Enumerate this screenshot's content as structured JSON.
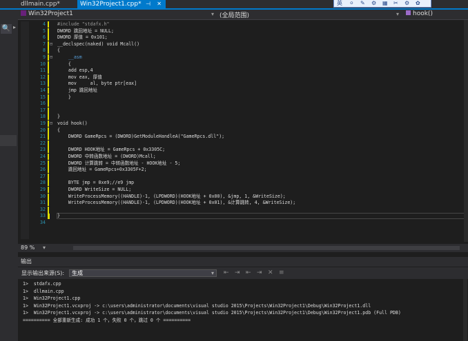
{
  "tabs": [
    {
      "label": "dllmain.cpp*"
    },
    {
      "label": "Win32Project1.cpp*",
      "pin": "⊣",
      "close": "✕"
    }
  ],
  "floating_toolbar": {
    "items": [
      "英",
      "⚪",
      "✎",
      "⚙",
      "▦",
      "✂",
      "⚙",
      "✿"
    ]
  },
  "nav": {
    "project": "Win32Project1",
    "scope": "(全局范围)",
    "function": "hook()",
    "dropdown_glyph": "▾"
  },
  "left_panel": {
    "search_glyph": "🔍",
    "arrow_glyph": "▸"
  },
  "editor": {
    "lines": [
      {
        "num": "4",
        "fold": "",
        "chg": true,
        "text": "#include \"stdafx.h\"",
        "color": "#9b9b9b"
      },
      {
        "num": "5",
        "fold": "",
        "chg": true,
        "text": "DWORD 跳回地址 = NULL;",
        "color": "#dcdcdc"
      },
      {
        "num": "6",
        "fold": "",
        "chg": true,
        "text": "DWORD 厚值 = 0x101;",
        "color": "#dcdcdc"
      },
      {
        "num": "7",
        "fold": "⊟",
        "chg": true,
        "text": "__declspec(naked) void Mcall()",
        "color": "#dcdcdc"
      },
      {
        "num": "8",
        "fold": "",
        "chg": true,
        "text": "{",
        "color": "#dcdcdc"
      },
      {
        "num": "9",
        "fold": "⊟",
        "chg": true,
        "text": "    __asm",
        "color": "#569cd6"
      },
      {
        "num": "10",
        "fold": "",
        "chg": true,
        "text": "    {",
        "color": "#dcdcdc"
      },
      {
        "num": "11",
        "fold": "",
        "chg": true,
        "text": "    add esp,4",
        "color": "#dcdcdc"
      },
      {
        "num": "12",
        "fold": "",
        "chg": true,
        "text": "    mov eax, 厚值",
        "color": "#dcdcdc"
      },
      {
        "num": "13",
        "fold": "",
        "chg": true,
        "text": "    mov     al, byte ptr[eax]",
        "color": "#dcdcdc"
      },
      {
        "num": "14",
        "fold": "",
        "chg": true,
        "text": "    jmp 跳回地址",
        "color": "#dcdcdc"
      },
      {
        "num": "15",
        "fold": "",
        "chg": true,
        "text": "    }",
        "color": "#dcdcdc"
      },
      {
        "num": "16",
        "fold": "",
        "chg": true,
        "text": "",
        "color": "#dcdcdc"
      },
      {
        "num": "17",
        "fold": "",
        "chg": true,
        "text": "",
        "color": "#dcdcdc"
      },
      {
        "num": "18",
        "fold": "",
        "chg": true,
        "text": "}",
        "color": "#dcdcdc"
      },
      {
        "num": "19",
        "fold": "⊟",
        "chg": true,
        "text": "void hook()",
        "color": "#dcdcdc"
      },
      {
        "num": "20",
        "fold": "",
        "chg": true,
        "text": "{",
        "color": "#dcdcdc"
      },
      {
        "num": "21",
        "fold": "",
        "chg": true,
        "text": "    DWORD GameRpcs = (DWORD)GetModuleHandleA(\"GameRpcs.dll\");",
        "color": "#dcdcdc"
      },
      {
        "num": "22",
        "fold": "",
        "chg": true,
        "text": "",
        "color": "#dcdcdc"
      },
      {
        "num": "23",
        "fold": "",
        "chg": true,
        "text": "    DWORD HOOK地址 = GameRpcs + 0x3305C;",
        "color": "#dcdcdc"
      },
      {
        "num": "24",
        "fold": "",
        "chg": true,
        "text": "    DWORD 中转函数地址 = (DWORD)Mcall;",
        "color": "#dcdcdc"
      },
      {
        "num": "25",
        "fold": "",
        "chg": true,
        "text": "    DWORD 计算跳转 = 中转函数地址 - HOOK地址 - 5;",
        "color": "#dcdcdc"
      },
      {
        "num": "26",
        "fold": "",
        "chg": true,
        "text": "    跳回地址 = GameRpcs+0x3305F+2;",
        "color": "#dcdcdc"
      },
      {
        "num": "27",
        "fold": "",
        "chg": true,
        "text": "",
        "color": "#dcdcdc"
      },
      {
        "num": "28",
        "fold": "",
        "chg": true,
        "text": "    BYTE jmp = 0xe9;//e9 jmp",
        "color": "#dcdcdc"
      },
      {
        "num": "29",
        "fold": "",
        "chg": true,
        "text": "    DWORD WriteSize = NULL;",
        "color": "#dcdcdc"
      },
      {
        "num": "30",
        "fold": "",
        "chg": true,
        "text": "    WriteProcessMemory((HANDLE)-1, (LPDWORD)(HOOK地址 + 0x00), &jmp, 1, &WriteSize);",
        "color": "#dcdcdc"
      },
      {
        "num": "31",
        "fold": "",
        "chg": true,
        "text": "    WriteProcessMemory((HANDLE)-1, (LPDWORD)(HOOK地址 + 0x01), &计算跳转, 4, &WriteSize);",
        "color": "#dcdcdc"
      },
      {
        "num": "32",
        "fold": "",
        "chg": true,
        "text": "",
        "color": "#dcdcdc"
      },
      {
        "num": "33",
        "fold": "",
        "chg": true,
        "text": "}",
        "color": "#dcdcdc"
      },
      {
        "num": "34",
        "fold": "",
        "chg": false,
        "text": "",
        "color": "#dcdcdc"
      }
    ]
  },
  "zoom": {
    "level": "89 %",
    "dropdown": "▾"
  },
  "output": {
    "title": "输出",
    "source_label": "显示输出来源(S):",
    "source_value": "生成",
    "toolbar_glyphs": [
      "⇤",
      "⇥",
      "⇤",
      "⇥",
      "✕",
      "≡"
    ],
    "lines": [
      "1>  stdafx.cpp",
      "1>  dllmain.cpp",
      "1>  Win32Project1.cpp",
      "1>  Win32Project1.vcxproj -> c:\\users\\administrator\\documents\\visual studio 2015\\Projects\\Win32Project1\\Debug\\Win32Project1.dll",
      "1>  Win32Project1.vcxproj -> c:\\users\\administrator\\documents\\visual studio 2015\\Projects\\Win32Project1\\Debug\\Win32Project1.pdb (Full PDB)",
      "========== 全部重新生成: 成功 1 个，失败 0 个，跳过 0 个 =========="
    ]
  }
}
